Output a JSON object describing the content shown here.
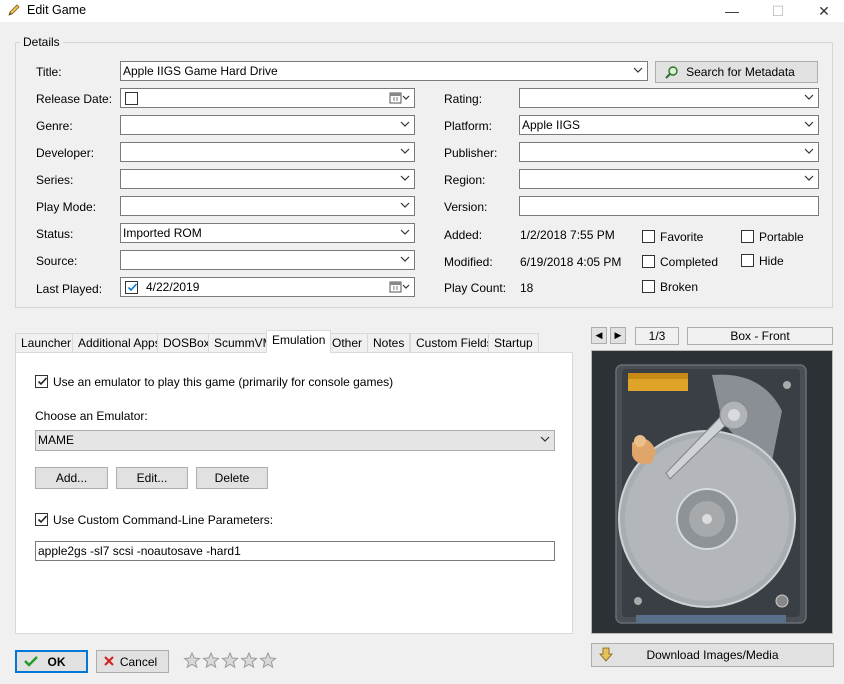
{
  "window": {
    "title": "Edit Game",
    "minimize": "—",
    "maximize": "☐",
    "close": "✕"
  },
  "details": {
    "legend": "Details",
    "title": {
      "label": "Title:",
      "value": "Apple IIGS Game Hard Drive"
    },
    "search_button": "Search for Metadata",
    "release_date": {
      "label": "Release Date:",
      "value": ""
    },
    "genre": {
      "label": "Genre:",
      "value": ""
    },
    "developer": {
      "label": "Developer:",
      "value": ""
    },
    "series": {
      "label": "Series:",
      "value": ""
    },
    "play_mode": {
      "label": "Play Mode:",
      "value": ""
    },
    "status": {
      "label": "Status:",
      "value": "Imported ROM"
    },
    "source": {
      "label": "Source:",
      "value": ""
    },
    "last_played": {
      "label": "Last Played:",
      "value": "4/22/2019"
    },
    "rating": {
      "label": "Rating:",
      "value": ""
    },
    "platform": {
      "label": "Platform:",
      "value": "Apple IIGS"
    },
    "publisher": {
      "label": "Publisher:",
      "value": ""
    },
    "region": {
      "label": "Region:",
      "value": ""
    },
    "version": {
      "label": "Version:",
      "value": ""
    },
    "added": {
      "label": "Added:",
      "value": "1/2/2018 7:55 PM"
    },
    "modified": {
      "label": "Modified:",
      "value": "6/19/2018 4:05 PM"
    },
    "play_count": {
      "label": "Play Count:",
      "value": "18"
    },
    "flags": {
      "favorite": "Favorite",
      "portable": "Portable",
      "completed": "Completed",
      "hide": "Hide",
      "broken": "Broken"
    }
  },
  "tabs": [
    "Launcher",
    "Additional Apps",
    "DOSBox",
    "ScummVM",
    "Emulation",
    "Other",
    "Notes",
    "Custom Fields",
    "Startup"
  ],
  "active_tab": "Emulation",
  "emulation": {
    "use_emulator": "Use an emulator to play this game (primarily for console games)",
    "choose_label": "Choose an Emulator:",
    "emulator": "MAME",
    "add": "Add...",
    "edit": "Edit...",
    "delete": "Delete",
    "use_custom": "Use Custom Command-Line Parameters:",
    "params": "apple2gs -sl7 scsi -noautosave -hard1"
  },
  "image": {
    "counter": "1/3",
    "type": "Box - Front",
    "prev": "◀",
    "next": "▶"
  },
  "download_button": "Download Images/Media",
  "footer": {
    "ok": "OK",
    "cancel": "Cancel",
    "rating_stars": 0
  },
  "colors": {
    "accent": "#0078d7",
    "ok_check": "#1f9d2a",
    "cancel_x": "#d21f1f"
  }
}
